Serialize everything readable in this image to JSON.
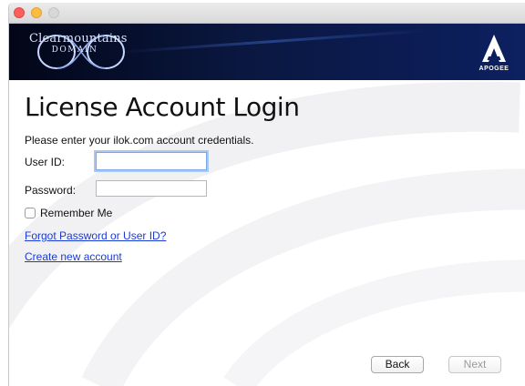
{
  "window": {
    "controls": [
      "close",
      "minimize",
      "zoom"
    ]
  },
  "banner": {
    "left_logo": {
      "line1": "Clearmountains",
      "line2": "DOMAIN"
    },
    "right_logo": {
      "word": "APOGEE"
    }
  },
  "form": {
    "title": "License Account Login",
    "instructions": "Please enter your ilok.com account credentials.",
    "user_id_label": "User ID:",
    "user_id_value": "",
    "password_label": "Password:",
    "password_value": "",
    "remember_label": "Remember Me",
    "remember_checked": false,
    "forgot_link": "Forgot Password or User ID?",
    "create_link": "Create new account"
  },
  "buttons": {
    "back": "Back",
    "next": "Next"
  },
  "colors": {
    "banner_dark": "#020617",
    "banner_blue": "#0d2060",
    "link": "#1a3bd8",
    "focus_ring": "#a9c8f4"
  },
  "icons": {
    "left_logo": "clearmountains-domain-logo",
    "right_logo": "apogee-logo"
  }
}
